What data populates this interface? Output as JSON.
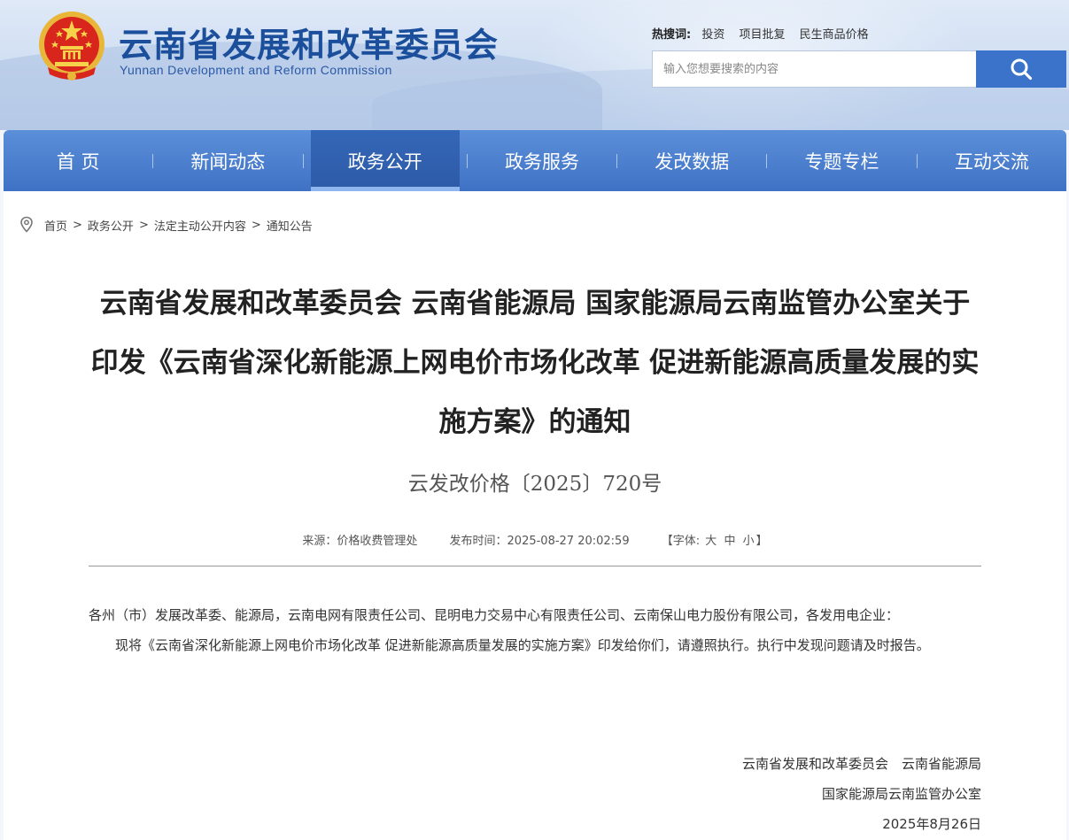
{
  "header": {
    "title": "云南省发展和改革委员会",
    "subtitle": "Yunnan Development and Reform Commission",
    "hot_label": "热搜词:",
    "hot_items": [
      "投资",
      "项目批复",
      "民生商品价格"
    ],
    "search_placeholder": "输入您想要搜索的内容"
  },
  "nav": {
    "items": [
      {
        "label": "首 页"
      },
      {
        "label": "新闻动态"
      },
      {
        "label": "政务公开"
      },
      {
        "label": "政务服务"
      },
      {
        "label": "发改数据"
      },
      {
        "label": "专题专栏"
      },
      {
        "label": "互动交流"
      }
    ],
    "active_index": 2
  },
  "breadcrumb": [
    "首页",
    "政务公开",
    "法定主动公开内容",
    "通知公告"
  ],
  "article": {
    "title": "云南省发展和改革委员会 云南省能源局 国家能源局云南监管办公室关于印发《云南省深化新能源上网电价市场化改革 促进新能源高质量发展的实施方案》的通知",
    "doc_number": "云发改价格〔2025〕720号",
    "source": "来源：价格收费管理处",
    "publish_time": "发布时间：2025-08-27 20:02:59",
    "font_size_label": "【字体:",
    "font_sizes": [
      "大",
      "中",
      "小"
    ],
    "font_size_end": "】",
    "paragraphs": [
      "各州（市）发展改革委、能源局，云南电网有限责任公司、昆明电力交易中心有限责任公司、云南保山电力股份有限公司，各发用电企业：",
      "现将《云南省深化新能源上网电价市场化改革 促进新能源高质量发展的实施方案》印发给你们，请遵照执行。执行中发现问题请及时报告。"
    ],
    "signature": {
      "line1": "云南省发展和改革委员会　云南省能源局",
      "line2": "国家能源局云南监管办公室",
      "date": "2025年8月26日"
    }
  },
  "colors": {
    "brand_blue": "#1b4f9c",
    "nav_blue": "#3f72c4",
    "search_button": "#3a73c9"
  }
}
